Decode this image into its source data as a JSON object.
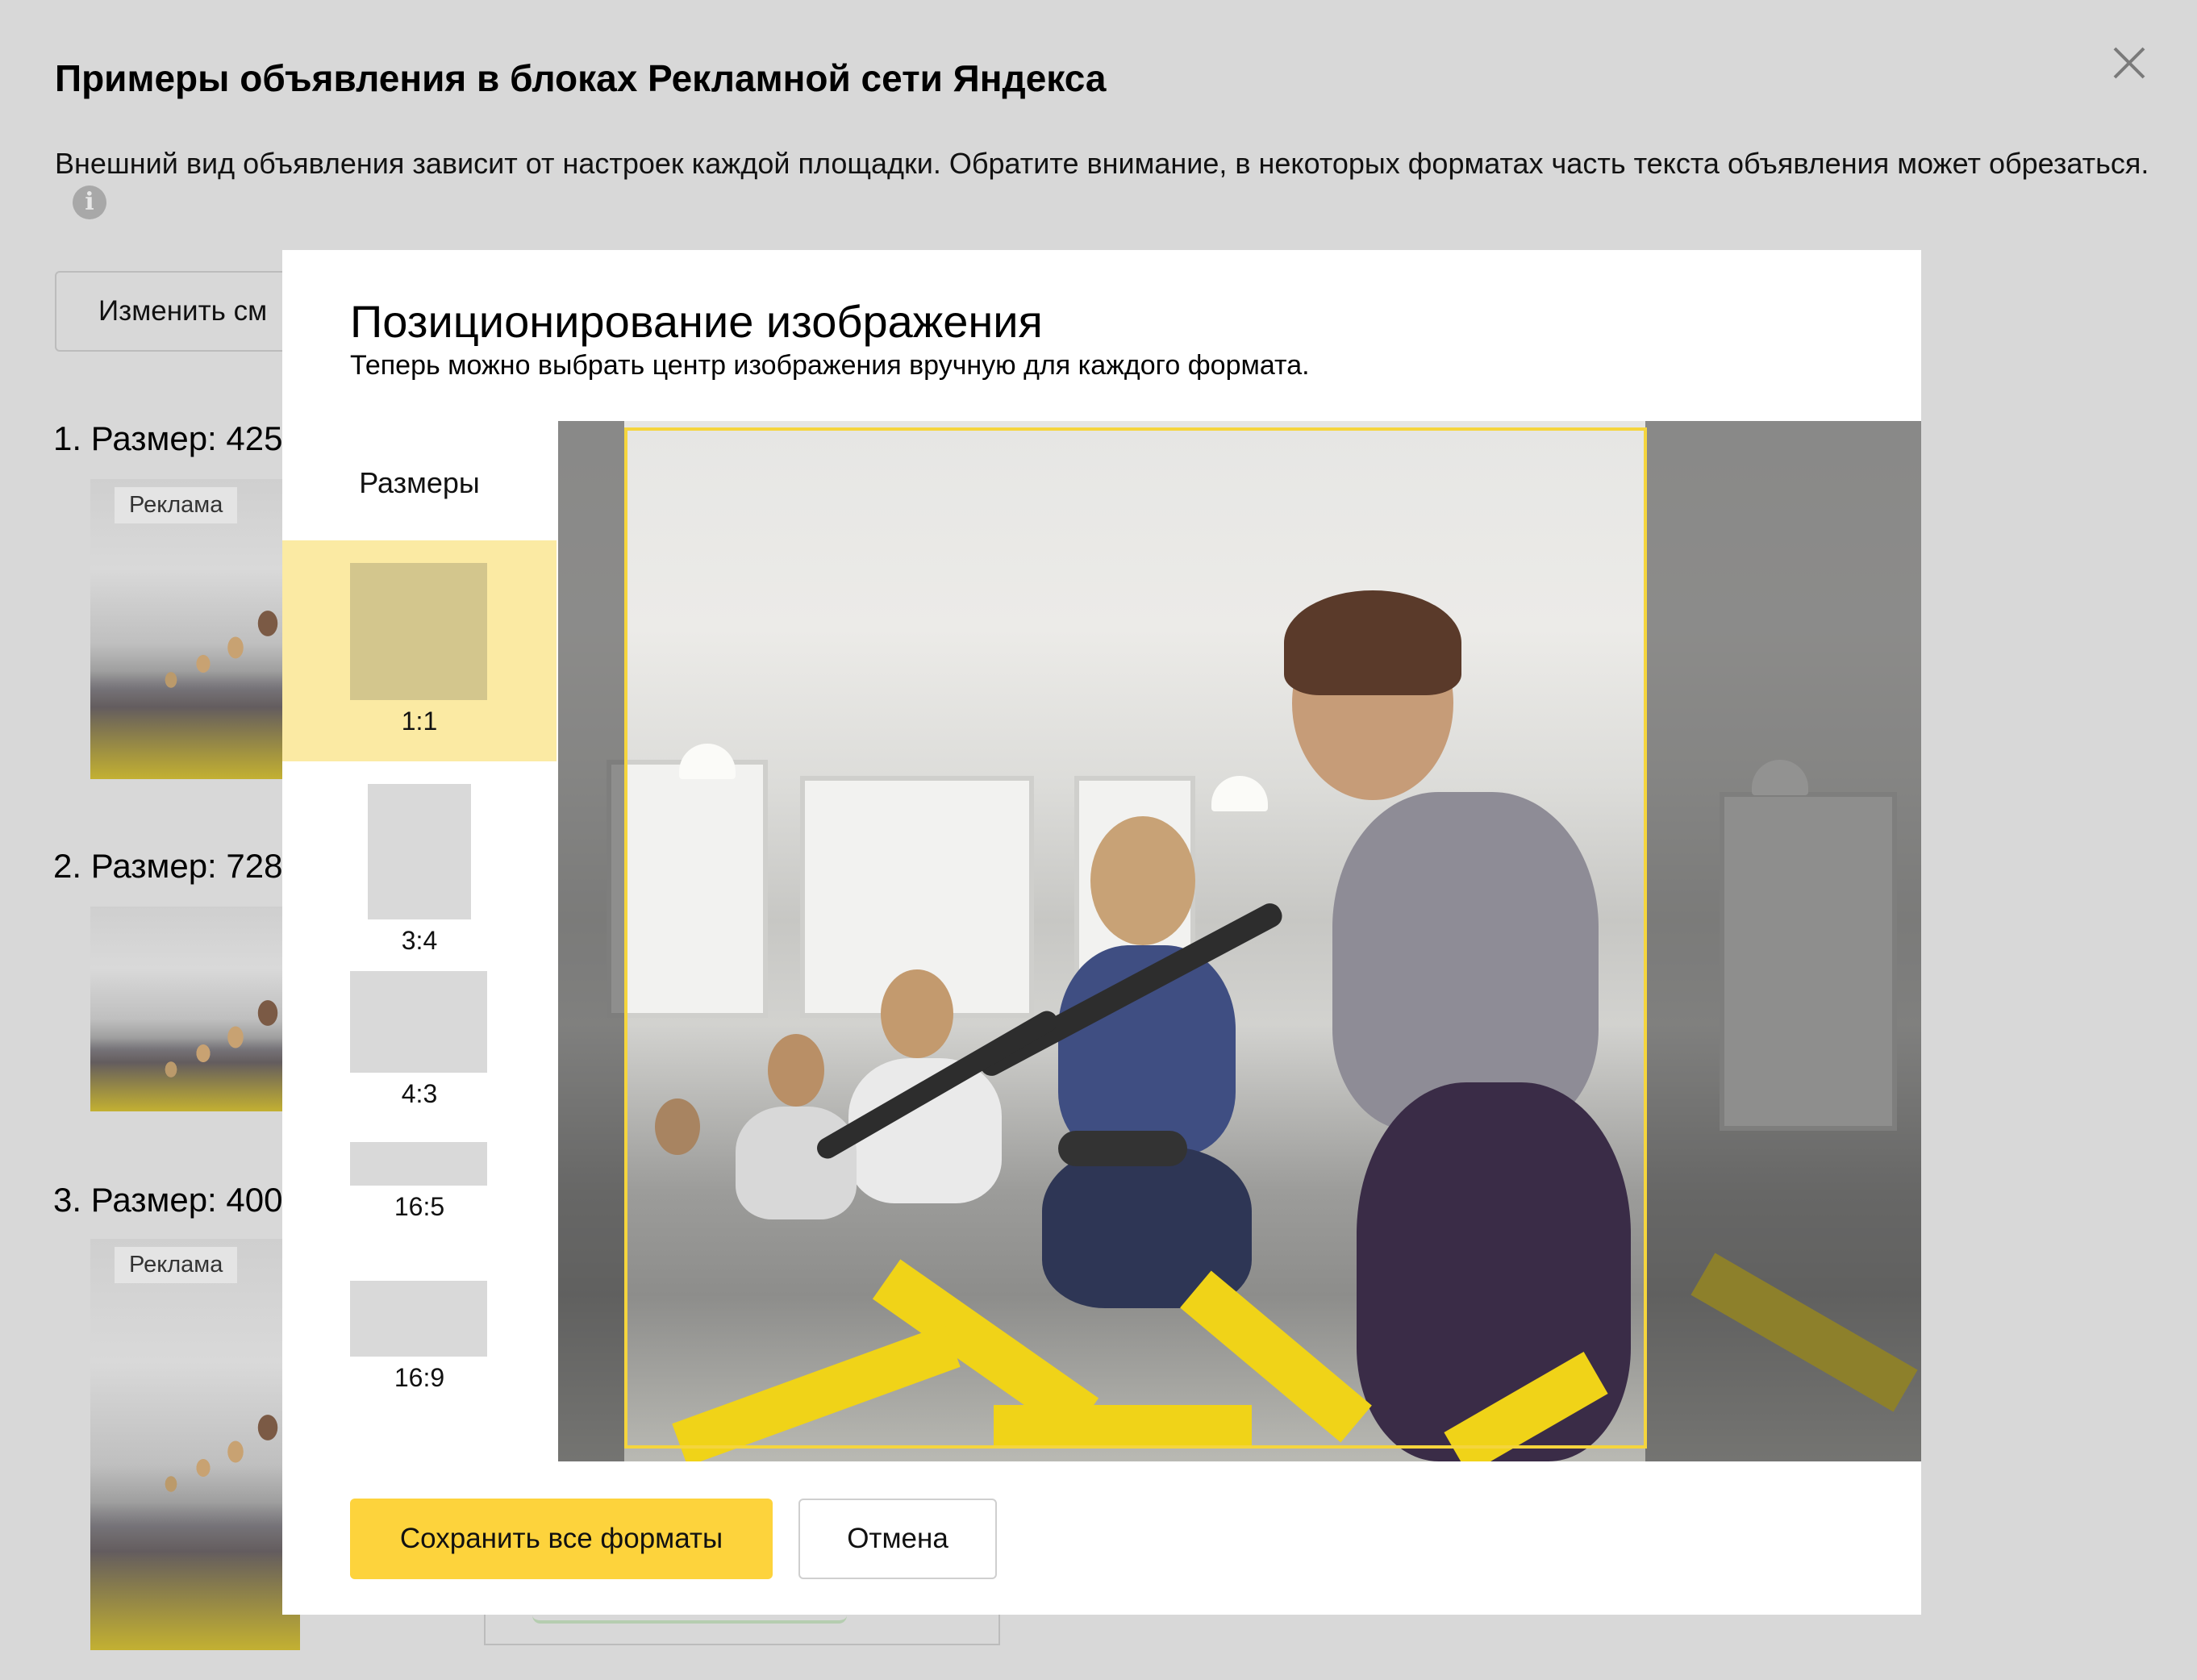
{
  "background_dialog": {
    "title": "Примеры объявления в блоках Рекламной сети Яндекса",
    "description": "Внешний вид объявления зависит от настроек каждой площадки. Обратите внимание, в некоторых форматах часть текста объявления может обрезаться.",
    "info_icon": "i",
    "close_icon": "close-icon",
    "change_button_label": "Изменить см",
    "sizes": [
      {
        "label": "1. Размер: 425"
      },
      {
        "label": "2. Размер: 728"
      },
      {
        "label": "3. Размер: 400"
      }
    ],
    "ad_label": "Реклама"
  },
  "modal": {
    "title": "Позиционирование изображения",
    "subtitle": "Теперь можно выбрать центр изображения вручную для каждого формата.",
    "sidebar_heading": "Размеры",
    "formats": [
      {
        "label": "1:1",
        "selected": true
      },
      {
        "label": "3:4",
        "selected": false
      },
      {
        "label": "4:3",
        "selected": false
      },
      {
        "label": "16:5",
        "selected": false
      },
      {
        "label": "16:9",
        "selected": false
      }
    ],
    "save_label": "Сохранить все форматы",
    "cancel_label": "Отмена"
  },
  "colors": {
    "accent": "#fdd33c",
    "selected_bg": "#fbeaa3",
    "crop_frame": "#f5d53d",
    "overlay": "#d8d8d8"
  }
}
